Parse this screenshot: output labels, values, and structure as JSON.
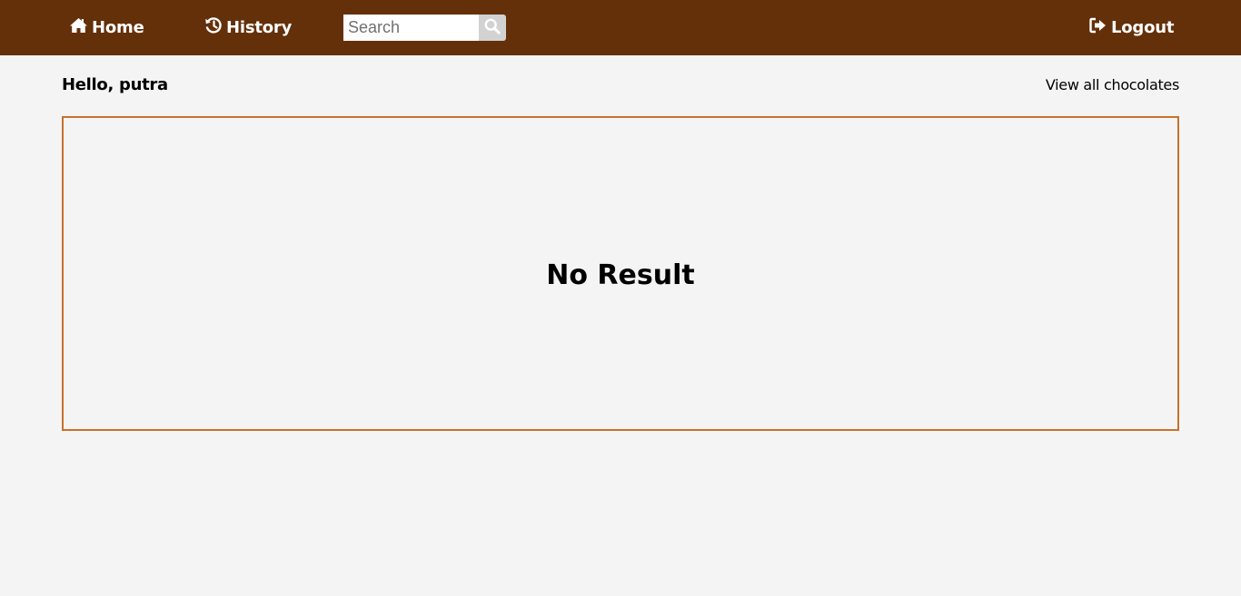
{
  "navbar": {
    "home_label": "Home",
    "history_label": "History",
    "logout_label": "Logout",
    "background_color": "#63300a"
  },
  "search": {
    "placeholder": "Search",
    "value": ""
  },
  "main": {
    "greeting": "Hello, putra",
    "view_all_label": "View all chocolates",
    "empty_message": "No Result",
    "box_border_color": "#c8712b"
  },
  "icons": {
    "home": "home-icon",
    "history": "history-icon",
    "search": "search-icon",
    "logout": "logout-icon"
  }
}
